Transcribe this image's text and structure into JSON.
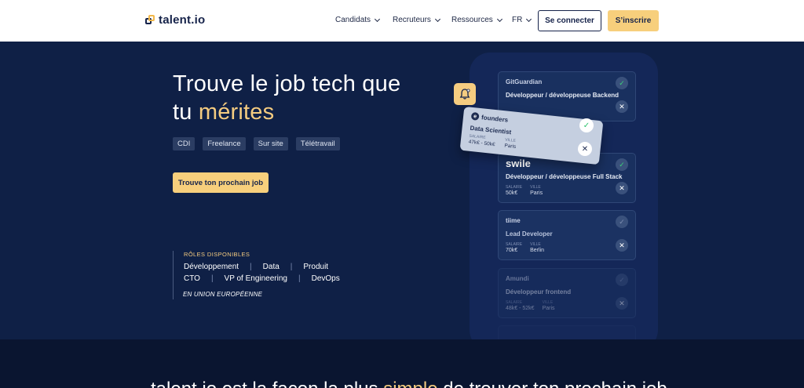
{
  "nav": {
    "logo_text": "talent.io",
    "menu": [
      {
        "label": "Candidats"
      },
      {
        "label": "Recruteurs"
      },
      {
        "label": "Ressources"
      },
      {
        "label": "FR"
      }
    ],
    "login_label": "Se connecter",
    "signup_label": "S’inscrire"
  },
  "hero": {
    "title_line1": "Trouve le job tech que",
    "title_line2_prefix": "tu ",
    "title_line2_highlight": "mérites",
    "tags": [
      "CDI",
      "Freelance",
      "Sur site",
      "Télétravail"
    ],
    "cta_label": "Trouve ton prochain job",
    "roles": {
      "title": "RÔLES DISPONIBLES",
      "row1": [
        "Développement",
        "Data",
        "Produit"
      ],
      "row2": [
        "CTO",
        "VP of Engineering",
        "DevOps"
      ],
      "footer": "EN UNION EUROPÉENNE"
    }
  },
  "cards": [
    {
      "company": "GitGuardian",
      "role": "Développeur / développeuse Backend",
      "salary_label": "",
      "salary": "",
      "city_label": "",
      "city": ""
    },
    {
      "company": "swile",
      "role": "Développeur / développeuse Full Stack",
      "salary_label": "SALAIRE",
      "salary": "50k€",
      "city_label": "VILLE",
      "city": "Paris"
    },
    {
      "company": "tiime",
      "role": "Lead Developer",
      "salary_label": "SALAIRE",
      "salary": "70k€",
      "city_label": "VILLE",
      "city": "Berlin"
    },
    {
      "company": "Amundi",
      "role": "Développeur frontend",
      "salary_label": "SALAIRE",
      "salary": "48k€ - 52k€",
      "city_label": "VILLE",
      "city": "Paris"
    }
  ],
  "float_card": {
    "company": "founders",
    "role": "Data Scientist",
    "salary_label": "SALAIRE",
    "salary": "47k€ - 50k€",
    "city_label": "VILLE",
    "city": "Paris"
  },
  "bottom": {
    "text_prefix": "talent.io est la façon la plus ",
    "text_highlight": "simple",
    "text_suffix": " de trouver ton prochain job"
  },
  "icons": {
    "check": "✓",
    "close": "✕"
  }
}
